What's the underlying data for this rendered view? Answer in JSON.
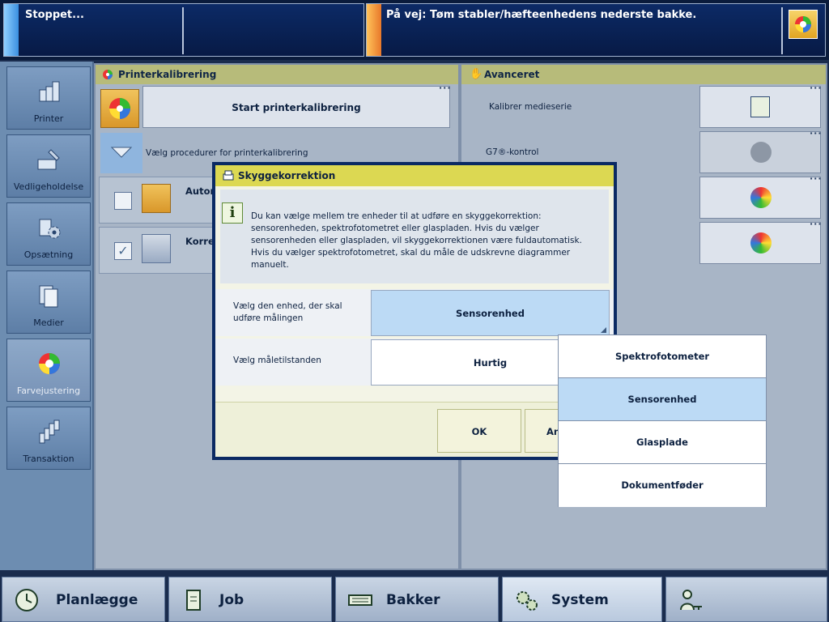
{
  "status": {
    "left_text": "Stoppet...",
    "right_text": "På vej: Tøm stabler/hæfteenhedens nederste bakke."
  },
  "sidebar": {
    "items": [
      {
        "label": "Printer"
      },
      {
        "label": "Vedligeholdelse"
      },
      {
        "label": "Opsætning"
      },
      {
        "label": "Medier"
      },
      {
        "label": "Farvejustering"
      },
      {
        "label": "Transaktion"
      }
    ]
  },
  "left_panel": {
    "title": "Printerkalibrering",
    "start_button": "Start printerkalibrering",
    "procedure_label": "Vælg procedurer for printerkalibrering",
    "row1_label": "Autom",
    "row2_label": "Korrek"
  },
  "right_panel": {
    "title": "Avanceret",
    "row1_label": "Kalibrer medieserie",
    "row2_label": "G7®-kontrol"
  },
  "dialog": {
    "title": "Skyggekorrektion",
    "info": "Du kan vælge mellem tre enheder til at udføre en skyggekorrektion: sensorenheden, spektrofotometret eller glaspladen. Hvis du vælger sensorenheden eller glaspladen, vil skyggekorrektionen være fuldautomatisk. Hvis du vælger spektrofotometret, skal du måle de udskrevne diagrammer manuelt.",
    "device_label": "Vælg den enhed, der skal udføre målingen",
    "device_value": "Sensorenhed",
    "mode_label": "Vælg måletilstanden",
    "mode_value": "Hurtig",
    "ok_label": "OK",
    "cancel_label": "An"
  },
  "dropdown": {
    "options": [
      "Spektrofotometer",
      "Sensorenhed",
      "Glasplade",
      "Dokumentføder"
    ],
    "selected": "Sensorenhed"
  },
  "bottom": {
    "plan": "Planlægge",
    "job": "Job",
    "trays": "Bakker",
    "system": "System"
  }
}
